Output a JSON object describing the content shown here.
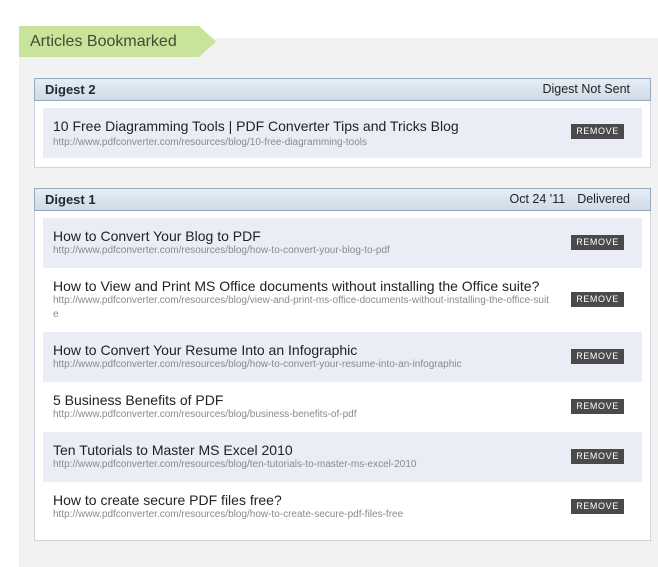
{
  "section_tab": {
    "label": "Articles Bookmarked"
  },
  "remove_label": "REMOVE",
  "digests": [
    {
      "title": "Digest 2",
      "date": "",
      "status": "Digest Not Sent",
      "articles": [
        {
          "title": "10 Free Diagramming Tools | PDF Converter Tips and Tricks Blog",
          "url": "http://www.pdfconverter.com/resources/blog/10-free-diagramming-tools"
        }
      ]
    },
    {
      "title": "Digest 1",
      "date": "Oct 24 '11",
      "status": "Delivered",
      "articles": [
        {
          "title": "How to Convert Your Blog to PDF",
          "url": "http://www.pdfconverter.com/resources/blog/how-to-convert-your-blog-to-pdf"
        },
        {
          "title": "How to View and Print MS Office documents without installing the Office suite?",
          "url": "http://www.pdfconverter.com/resources/blog/view-and-print-ms-office-documents-without-installing-the-office-suite"
        },
        {
          "title": "How to Convert Your Resume Into an Infographic",
          "url": "http://www.pdfconverter.com/resources/blog/how-to-convert-your-resume-into-an-infographic"
        },
        {
          "title": "5 Business Benefits of PDF",
          "url": "http://www.pdfconverter.com/resources/blog/business-benefits-of-pdf"
        },
        {
          "title": "Ten Tutorials to Master MS Excel 2010",
          "url": "http://www.pdfconverter.com/resources/blog/ten-tutorials-to-master-ms-excel-2010"
        },
        {
          "title": "How to create secure PDF files free?",
          "url": "http://www.pdfconverter.com/resources/blog/how-to-create-secure-pdf-files-free"
        }
      ]
    }
  ],
  "colors": {
    "tab_green": "#c8e39a",
    "header_blue": "#d5e0ec",
    "row_shade": "#eaedf5",
    "button": "#4a4a4a"
  }
}
